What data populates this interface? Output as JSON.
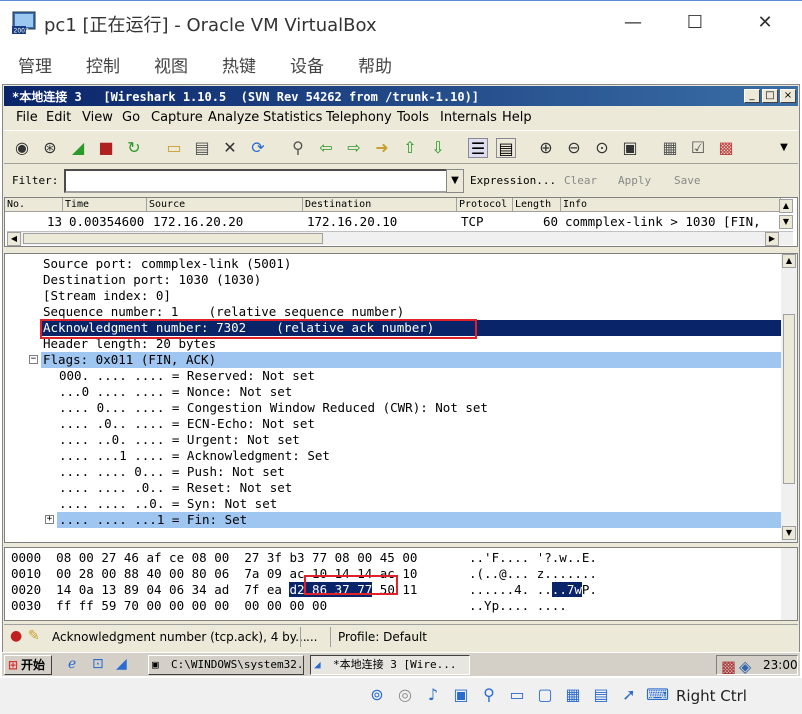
{
  "vbox": {
    "title": "pc1 [正在运行] - Oracle VM VirtualBox",
    "menu": [
      "管理",
      "控制",
      "视图",
      "热键",
      "设备",
      "帮助"
    ],
    "host_key": "Right Ctrl"
  },
  "wireshark": {
    "title": "*本地连接 3   [Wireshark 1.10.5  (SVN Rev 54262 from /trunk-1.10)]",
    "menu": [
      "File",
      "Edit",
      "View",
      "Go",
      "Capture",
      "Analyze",
      "Statistics",
      "Telephony",
      "Tools",
      "Internals",
      "Help"
    ],
    "filter": {
      "label": "Filter:",
      "value": "",
      "expression": "Expression...",
      "clear": "Clear",
      "apply": "Apply",
      "save": "Save"
    },
    "packet_list": {
      "columns": [
        "No.",
        "Time",
        "Source",
        "Destination",
        "Protocol",
        "Length",
        "Info"
      ],
      "row": {
        "no": "13",
        "time": "0.00354600",
        "source": "172.16.20.20",
        "destination": "172.16.20.10",
        "protocol": "TCP",
        "length": "60",
        "info": "commplex-link > 1030 [FIN,"
      }
    },
    "details": [
      {
        "text": "Source port: commplex-link (5001)",
        "indent": 1,
        "state": "normal"
      },
      {
        "text": "Destination port: 1030 (1030)",
        "indent": 1,
        "state": "normal"
      },
      {
        "text": "[Stream index: 0]",
        "indent": 1,
        "state": "normal"
      },
      {
        "text": "Sequence number: 1    (relative sequence number)",
        "indent": 1,
        "state": "normal"
      },
      {
        "text": "Acknowledgment number: 7302    (relative ack number)",
        "indent": 1,
        "state": "selected"
      },
      {
        "text": "Header length: 20 bytes",
        "indent": 1,
        "state": "normal"
      },
      {
        "text": "Flags: 0x011 (FIN, ACK)",
        "indent": 1,
        "state": "highlight",
        "expander": "−"
      },
      {
        "text": "000. .... .... = Reserved: Not set",
        "indent": 2,
        "state": "normal"
      },
      {
        "text": "...0 .... .... = Nonce: Not set",
        "indent": 2,
        "state": "normal"
      },
      {
        "text": ".... 0... .... = Congestion Window Reduced (CWR): Not set",
        "indent": 2,
        "state": "normal"
      },
      {
        "text": ".... .0.. .... = ECN-Echo: Not set",
        "indent": 2,
        "state": "normal"
      },
      {
        "text": ".... ..0. .... = Urgent: Not set",
        "indent": 2,
        "state": "normal"
      },
      {
        "text": ".... ...1 .... = Acknowledgment: Set",
        "indent": 2,
        "state": "normal"
      },
      {
        "text": ".... .... 0... = Push: Not set",
        "indent": 2,
        "state": "normal"
      },
      {
        "text": ".... .... .0.. = Reset: Not set",
        "indent": 2,
        "state": "normal"
      },
      {
        "text": ".... .... ..0. = Syn: Not set",
        "indent": 2,
        "state": "normal"
      },
      {
        "text": ".... .... ...1 = Fin: Set",
        "indent": 2,
        "state": "highlight",
        "expander": "+"
      }
    ],
    "hex": [
      {
        "offset": "0000",
        "bytes_pre": "08 00 27 46 af ce 08 00  27 3f b3 77 08 00 45 00",
        "bytes_sel": "",
        "bytes_post": "",
        "ascii_pre": "..'F.... '?.w..E.",
        "ascii_sel": "",
        "ascii_post": ""
      },
      {
        "offset": "0010",
        "bytes_pre": "00 28 00 88 40 00 80 06  7a 09 ac 10 14 14 ac 10",
        "bytes_sel": "",
        "bytes_post": "",
        "ascii_pre": ".(..@... z.......",
        "ascii_sel": "",
        "ascii_post": ""
      },
      {
        "offset": "0020",
        "bytes_pre": "14 0a 13 89 04 06 34 ad  7f ea ",
        "bytes_sel": "d2 86 37 77",
        "bytes_post": " 50 11",
        "ascii_pre": "......4. ..",
        "ascii_sel": "..7w",
        "ascii_post": "P."
      },
      {
        "offset": "0030",
        "bytes_pre": "ff ff 59 70 00 00 00 00  00 00 00 00",
        "bytes_sel": "",
        "bytes_post": "",
        "ascii_pre": "..Yp.... ....",
        "ascii_sel": "",
        "ascii_post": ""
      }
    ],
    "status": {
      "field": "Acknowledgment number (tcp.ack), 4 by...",
      "middle": "...",
      "profile": "Profile: Default"
    }
  },
  "taskbar": {
    "start": "开始",
    "tasks": [
      "C:\\WINDOWS\\system32...",
      "*本地连接 3   [Wire..."
    ],
    "clock": "23:00",
    "tray_badge": "2003"
  },
  "colors": {
    "selection_dark": "#0a246a",
    "selection_light": "#9fc6f0",
    "annotation_red": "#e0202a"
  }
}
